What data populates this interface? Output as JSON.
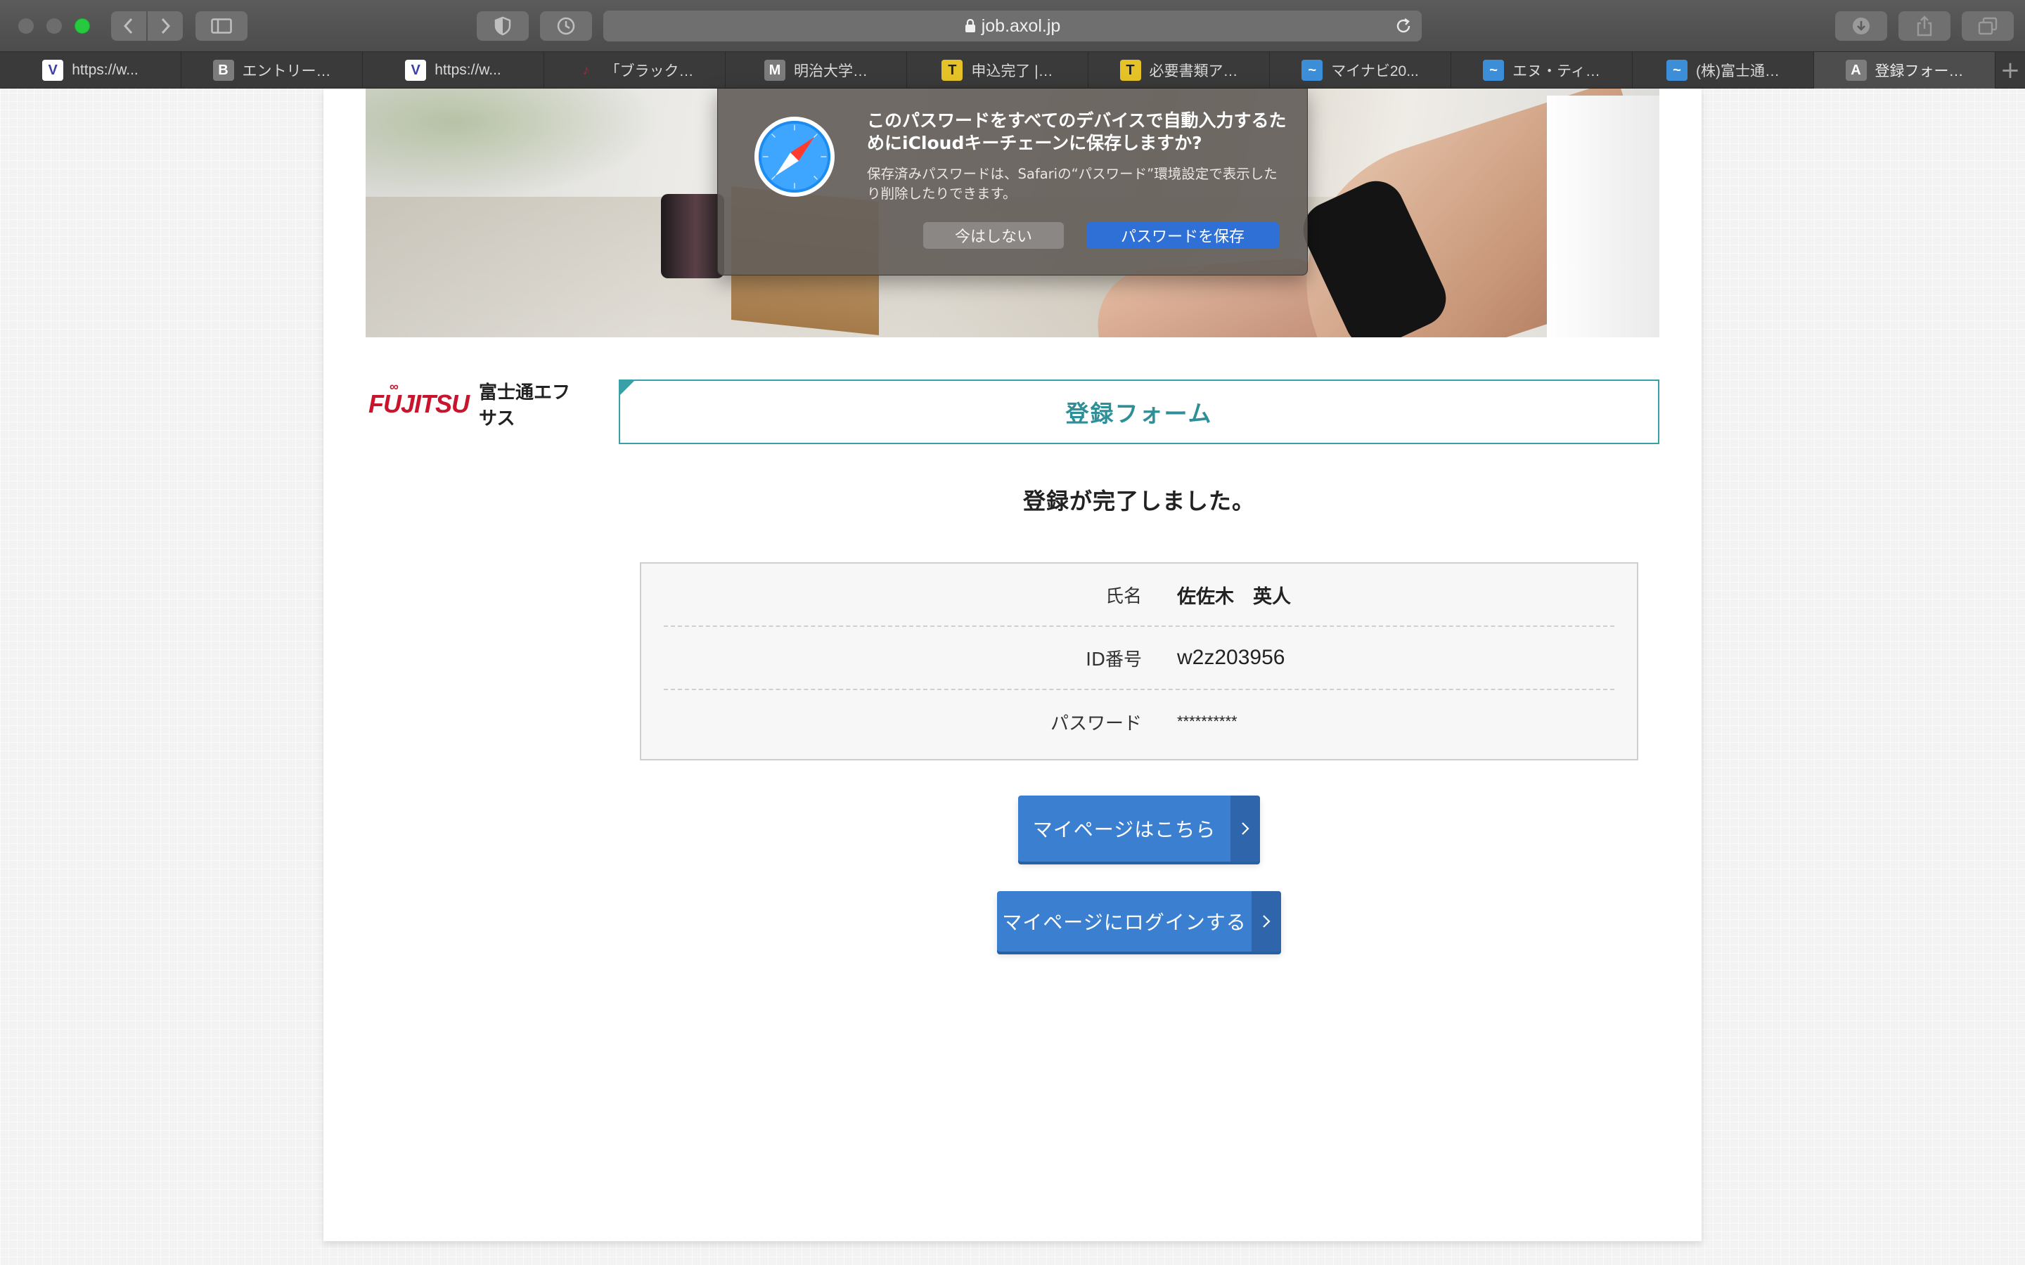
{
  "browser": {
    "url": "job.axol.jp",
    "tabs": [
      {
        "label": "https://w...",
        "icon": "V",
        "icon_color": "#3b3fa8"
      },
      {
        "label": "エントリー…",
        "icon": "B",
        "icon_color": "#7c7c7c"
      },
      {
        "label": "https://w...",
        "icon": "V",
        "icon_color": "#3b3fa8"
      },
      {
        "label": "「ブラック…",
        "icon": "♪",
        "icon_color": "#c8142c"
      },
      {
        "label": "明治大学…",
        "icon": "M",
        "icon_color": "#7c7c7c"
      },
      {
        "label": "申込完了 |…",
        "icon": "T",
        "icon_color": "#e6c229"
      },
      {
        "label": "必要書類ア…",
        "icon": "T",
        "icon_color": "#e6c229"
      },
      {
        "label": "マイナビ20...",
        "icon": "~",
        "icon_color": "#3d8ed8"
      },
      {
        "label": "エヌ・ティ…",
        "icon": "~",
        "icon_color": "#3d8ed8"
      },
      {
        "label": "(株)富士通…",
        "icon": "~",
        "icon_color": "#3d8ed8"
      },
      {
        "label": "登録フォー…",
        "icon": "A",
        "icon_color": "#7c7c7c"
      }
    ],
    "new_tab": "+"
  },
  "dialog": {
    "title": "このパスワードをすべてのデバイスで自動入力するためにiCloudキーチェーンに保存しますか?",
    "body": "保存済みパスワードは、Safariの“パスワード”環境設定で表示したり削除したりできます。",
    "not_now": "今はしない",
    "save": "パスワードを保存"
  },
  "logo": {
    "brand": "FUJITSU",
    "company": "富士通エフサス"
  },
  "form": {
    "title": "登録フォーム",
    "complete_message": "登録が完了しました。",
    "fields": [
      {
        "label": "氏名",
        "value": "佐佐木　英人"
      },
      {
        "label": "ID番号",
        "value": "w2z203956"
      },
      {
        "label": "パスワード",
        "value": "**********"
      }
    ],
    "mypage_button": "マイページはこちら",
    "login_button": "マイページにログインする"
  },
  "colors": {
    "accent_teal": "#39a0a8",
    "button_blue": "#3b7fd0",
    "dialog_save_blue": "#2f70d6",
    "fujitsu_red": "#c8142c"
  }
}
